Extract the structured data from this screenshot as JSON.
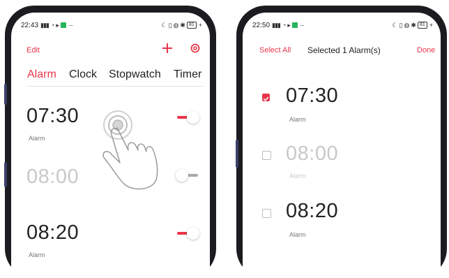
{
  "left": {
    "status": {
      "time": "22:43",
      "battery": "81"
    },
    "header": {
      "edit_label": "Edit",
      "add_icon": "plus-icon",
      "settings_icon": "settings-ring-icon"
    },
    "tabs": [
      "Alarm",
      "Clock",
      "Stopwatch",
      "Timer"
    ],
    "alarms": [
      {
        "time": "07:30",
        "label": "Alarm",
        "enabled": true
      },
      {
        "time": "08:00",
        "label": "",
        "enabled": false
      },
      {
        "time": "08:20",
        "label": "Alarm",
        "enabled": true
      }
    ],
    "gesture_icon": "long-press-hand-icon"
  },
  "right": {
    "status": {
      "time": "22:50",
      "battery": "81"
    },
    "header": {
      "select_all_label": "Select All",
      "title": "Selected 1 Alarm(s)",
      "done_label": "Done"
    },
    "alarms": [
      {
        "time": "07:30",
        "label": "Alarm",
        "selected": true,
        "enabled": true
      },
      {
        "time": "08:00",
        "label": "Alarm",
        "selected": false,
        "enabled": false
      },
      {
        "time": "08:20",
        "label": "Alarm",
        "selected": false,
        "enabled": true
      }
    ]
  },
  "colors": {
    "accent": "#e8364b",
    "text": "#222222",
    "disabled": "#c9c9c9",
    "frame": "#1c1c20"
  }
}
